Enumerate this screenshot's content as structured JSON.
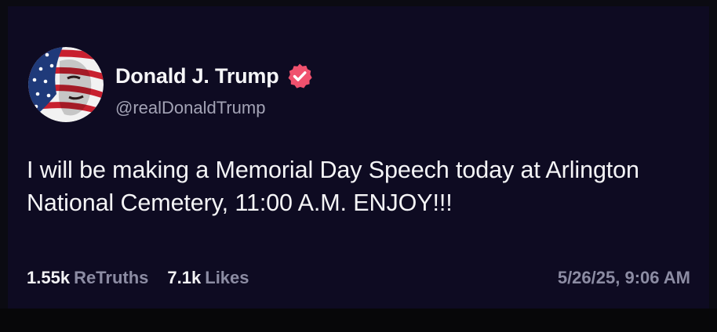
{
  "post": {
    "author": {
      "display_name": "Donald J. Trump",
      "handle": "@realDonaldTrump",
      "verified": true,
      "avatar_icon": "flag-portrait-avatar"
    },
    "text": "I will be making a Memorial Day Speech today at Arlington National Cemetery, 11:00 A.M. ENJOY!!!",
    "stats": {
      "retruths_count": "1.55k",
      "retruths_label": "ReTruths",
      "likes_count": "7.1k",
      "likes_label": "Likes"
    },
    "timestamp": "5/26/25, 9:06 AM"
  },
  "colors": {
    "background": "#0e0b22",
    "verified_badge": "#f0516e",
    "muted_text": "#8c8ca3"
  }
}
